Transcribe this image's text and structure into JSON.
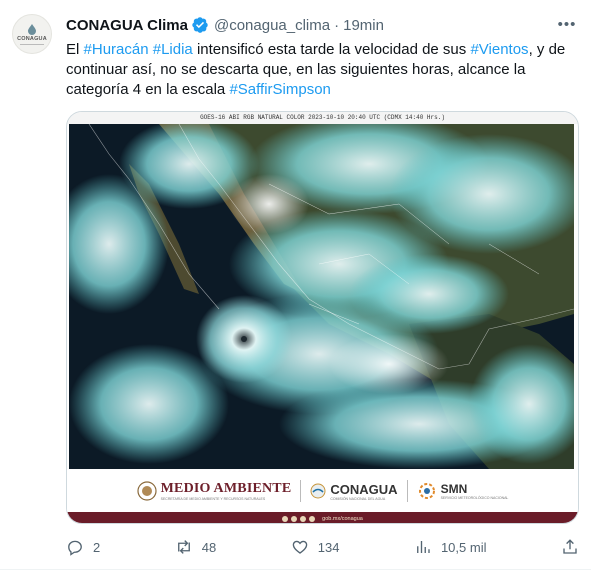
{
  "account": {
    "name": "CONAGUA Clima",
    "handle": "@conagua_clima",
    "separator": "·",
    "time": "19min",
    "avatar_text": "CONAGUA"
  },
  "tweet": {
    "segments": [
      {
        "text": "El ",
        "type": "text"
      },
      {
        "text": "#Huracán",
        "type": "hashtag"
      },
      {
        "text": " ",
        "type": "text"
      },
      {
        "text": "#Lidia",
        "type": "hashtag"
      },
      {
        "text": " intensificó esta tarde la velocidad de sus ",
        "type": "text"
      },
      {
        "text": "#Vientos",
        "type": "hashtag"
      },
      {
        "text": ", y de continuar así, no se descarta que, en las siguientes horas, alcance la categoría 4 en la escala ",
        "type": "text"
      },
      {
        "text": "#SaffirSimpson",
        "type": "hashtag"
      }
    ]
  },
  "media": {
    "sat_title": "GOES-16 ABI RGB NATURAL COLOR 2023-10-10 20:40 UTC (CDMX 14:40 Hrs.)",
    "sat_logos": "CONAGUA · SMN",
    "medio_ambiente": "MEDIO AMBIENTE",
    "medio_ambiente_sub": "SECRETARÍA DE MEDIO AMBIENTE Y RECURSOS NATURALES",
    "conagua": "CONAGUA",
    "conagua_sub": "COMISIÓN NACIONAL DEL AGUA",
    "smn": "SMN",
    "smn_sub": "SERVICIO METEOROLÓGICO NACIONAL",
    "social_text": "gob.mx/conagua"
  },
  "actions": {
    "replies": "2",
    "reposts": "48",
    "likes": "134",
    "views": "10,5 mil"
  },
  "colors": {
    "hashtag": "#1d9bf0",
    "verified": "#1d9bf0",
    "muted": "#536471",
    "brand_maroon": "#6a1c28"
  },
  "icons": [
    "verified-badge-icon",
    "more-icon",
    "reply-icon",
    "repost-icon",
    "like-icon",
    "views-icon",
    "share-icon"
  ]
}
